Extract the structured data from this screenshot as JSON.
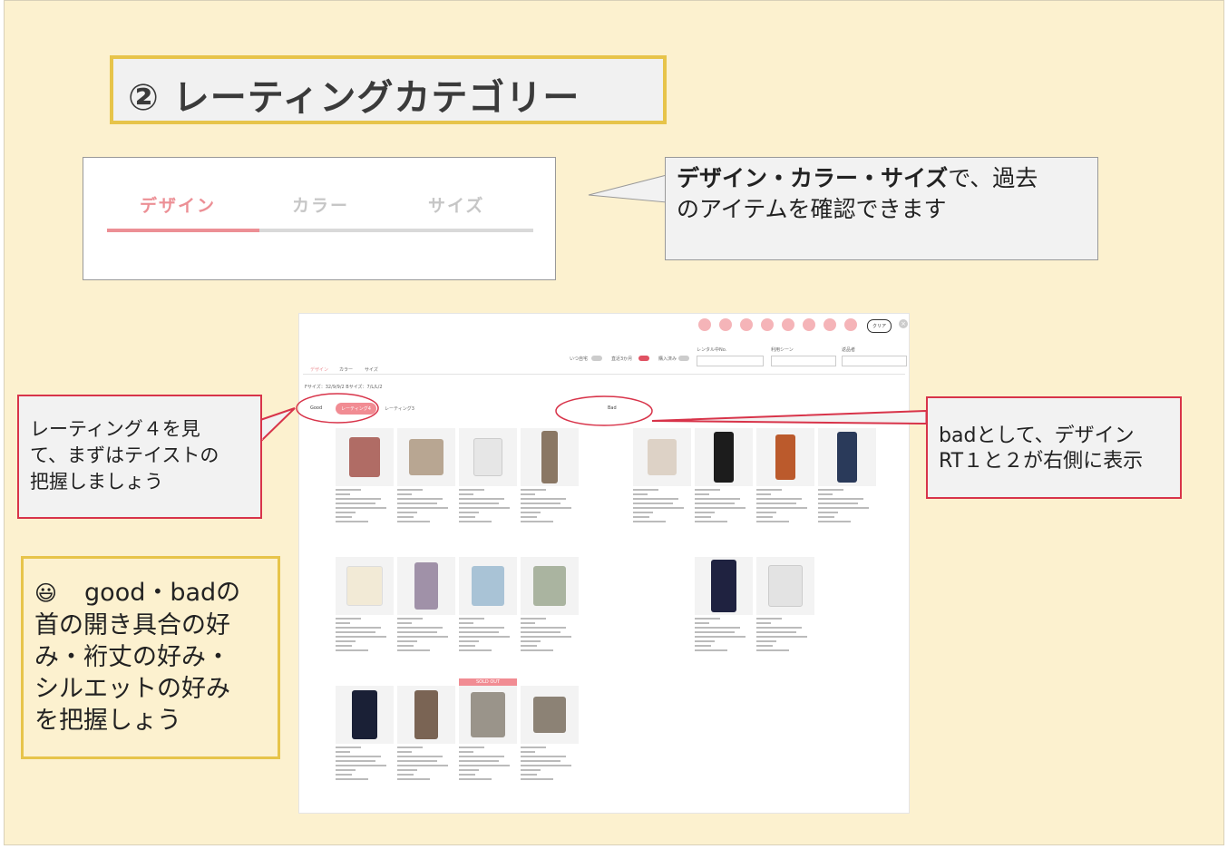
{
  "title": "② レーティングカテゴリー",
  "tabs": [
    "デザイン",
    "カラー",
    "サイズ"
  ],
  "callout_top": {
    "bold": "デザイン・カラー・サイズ",
    "rest_line1": "で、過去",
    "line2": "のアイテムを確認できます"
  },
  "callout_left": [
    "レーティング４を見",
    "て、まずはテイストの",
    "把握しましょう"
  ],
  "callout_right": [
    "badとして、デザイン",
    "RT１と２が右側に表示"
  ],
  "note": {
    "emoji": "😃",
    "lines": [
      "good・badの",
      "首の開き具合の好",
      "み・裄丈の好み・",
      "シルエットの好み",
      "を把握しょう"
    ]
  },
  "screenshot": {
    "clear_button": "クリア",
    "filters": {
      "once": "いつ自宅",
      "last": "直近3か月",
      "purchased": "購入済み"
    },
    "fields": {
      "brand": "レンタル中No.",
      "member": "利用シーン",
      "repeat": "返品者"
    },
    "mini_tabs": [
      "デザイン",
      "カラー",
      "サイズ"
    ],
    "size_line": "Fサイズ：32/9/9/2  Bサイズ：7/L/L/2",
    "good_label": "Good",
    "pill_selected": "レーティング4",
    "pill_other": "レーティング3",
    "bad_label": "Bad",
    "sold_out": "SOLD OUT"
  },
  "colors": {
    "accent_pink": "#ec8f95",
    "callout_red": "#d8344a",
    "title_border": "#e7c44a",
    "slide_bg": "#fcf1cf"
  }
}
